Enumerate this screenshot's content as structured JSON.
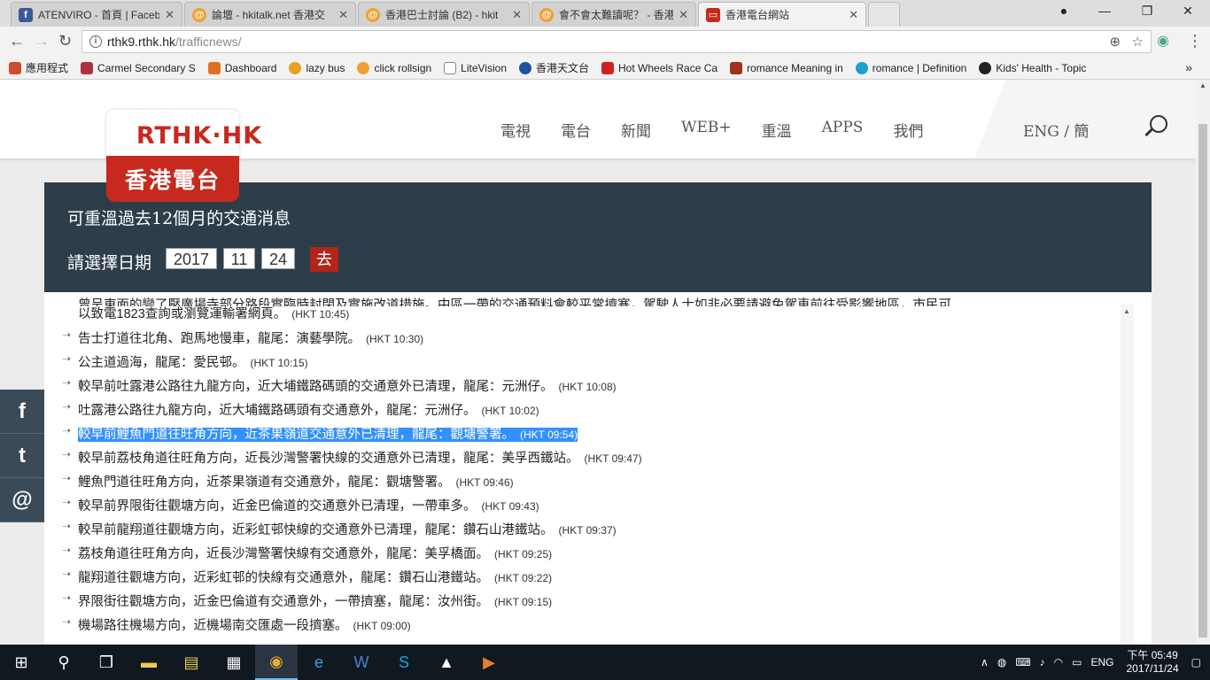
{
  "browser": {
    "tabs": [
      {
        "label": "ATENVIRO - 首頁 | Faceb",
        "icon": "facebook-icon",
        "color": "#3b5998",
        "active": false
      },
      {
        "label": "論壇 - hkitalk.net 香港交",
        "icon": "hkitalk-icon",
        "color": "#f0a030",
        "active": false
      },
      {
        "label": "香港巴士討論 (B2) - hkit",
        "icon": "hkitalk-icon",
        "color": "#f0a030",
        "active": false
      },
      {
        "label": "會不會太難讀呢？ - 香港",
        "icon": "hkitalk-icon",
        "color": "#f0a030",
        "active": false
      },
      {
        "label": "香港電台網站",
        "icon": "rthk-icon",
        "color": "#c8291e",
        "active": true
      }
    ],
    "address": {
      "host": "rthk9.rthk.hk",
      "path": "/trafficnews/"
    },
    "bookmarks": [
      {
        "label": "應用程式",
        "color": "#d04a30"
      },
      {
        "label": "Carmel Secondary S",
        "color": "#b03040"
      },
      {
        "label": "Dashboard",
        "color": "#e07020"
      },
      {
        "label": "lazy bus",
        "color": "#e8a020"
      },
      {
        "label": "click rollsign",
        "color": "#f0a030"
      },
      {
        "label": "LiteVision",
        "color": "#888888"
      },
      {
        "label": "香港天文台",
        "color": "#2050a0"
      },
      {
        "label": "Hot Wheels Race Ca",
        "color": "#d02020"
      },
      {
        "label": "romance Meaning in",
        "color": "#a03020"
      },
      {
        "label": "romance | Definition",
        "color": "#20a0d0"
      },
      {
        "label": "Kids' Health - Topic",
        "color": "#222222"
      }
    ],
    "bookmarks_more": "»"
  },
  "site": {
    "logo_en": "RTHK·HK",
    "logo_zh": "香港電台",
    "nav": [
      "電視",
      "電台",
      "新聞",
      "WEB+",
      "重溫",
      "APPS",
      "我們"
    ],
    "lang": "ENG / 簡",
    "panel": {
      "title": "可重溫過去12個月的交通消息",
      "date_label": "請選擇日期",
      "year": "2017",
      "month": "11",
      "day": "24",
      "go": "去"
    }
  },
  "traffic": {
    "partial_text": "曾呈東面的變了壓廣場寺部分路段實臨時封閉及實施改道措施。中區一帶的交通預料會較平常擠塞，駕駛人士如非必要請避免駕車前往受影響地區，市民可",
    "partial_text2": "以致電1823查詢或瀏覽運輸署網頁。",
    "partial_time": "(HKT 10:45)",
    "items": [
      {
        "text": "告士打道往北角、跑馬地慢車，龍尾：演藝學院。",
        "time": "(HKT 10:30)"
      },
      {
        "text": "公主道過海，龍尾：愛民邨。",
        "time": "(HKT 10:15)"
      },
      {
        "text": "較早前吐露港公路往九龍方向，近大埔鐵路碼頭的交通意外已清理，龍尾：元洲仔。",
        "time": "(HKT 10:08)"
      },
      {
        "text": "吐露港公路往九龍方向，近大埔鐵路碼頭有交通意外，龍尾：元洲仔。",
        "time": "(HKT 10:02)"
      },
      {
        "text": "較早前鯉魚門道往旺角方向，近茶果嶺道交通意外已清理，龍尾：觀塘警署。",
        "time": "(HKT 09:54)"
      },
      {
        "text": "較早前荔枝角道往旺角方向，近長沙灣警署快線的交通意外已清理，龍尾：美孚西鐵站。",
        "time": "(HKT 09:47)"
      },
      {
        "text": "鯉魚門道往旺角方向，近茶果嶺道有交通意外，龍尾：觀塘警署。",
        "time": "(HKT 09:46)"
      },
      {
        "text": "較早前界限街往觀塘方向，近金巴倫道的交通意外已清理，一帶車多。",
        "time": "(HKT 09:43)"
      },
      {
        "text": "較早前龍翔道往觀塘方向，近彩虹邨快線的交通意外已清理，龍尾：鑽石山港鐵站。",
        "time": "(HKT 09:37)"
      },
      {
        "text": "荔枝角道往旺角方向，近長沙灣警署快線有交通意外，龍尾：美孚橋面。",
        "time": "(HKT 09:25)"
      },
      {
        "text": "龍翔道往觀塘方向，近彩虹邨的快線有交通意外，龍尾：鑽石山港鐵站。",
        "time": "(HKT 09:22)"
      },
      {
        "text": "界限街往觀塘方向，近金巴倫道有交通意外，一帶擠塞，龍尾：汝州街。",
        "time": "(HKT 09:15)"
      },
      {
        "text": "機場路往機場方向，近機場南交匯處一段擠塞。",
        "time": "(HKT 09:00)"
      }
    ]
  },
  "social": [
    "f",
    "t",
    "@"
  ],
  "taskbar": {
    "lang": "ENG",
    "time": "下午 05:49",
    "date": "2017/11/24"
  }
}
